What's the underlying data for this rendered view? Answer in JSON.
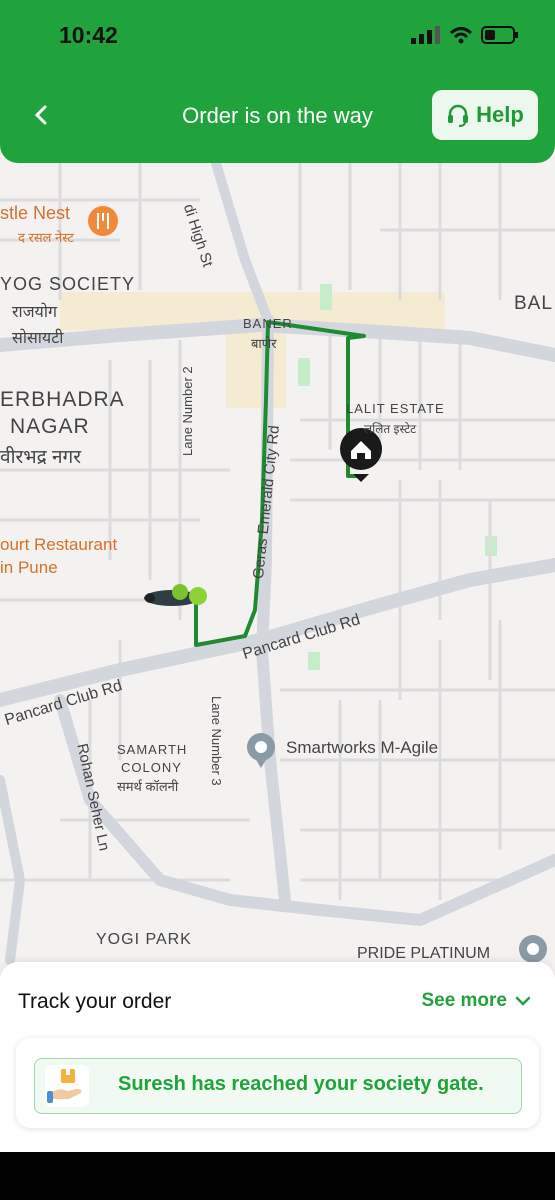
{
  "status_bar": {
    "time": "10:42"
  },
  "header": {
    "title": "Order is on the way",
    "help_label": "Help"
  },
  "map": {
    "labels": {
      "bustle_nest": "stle Nest",
      "bustle_nest_hi": "द रसल नेस्ट",
      "yog_society": "YOG SOCIETY",
      "rajyog": "राजयोग",
      "society_hi": "सोसायटी",
      "high_st": "di High St",
      "baner": "BANER",
      "baner_hi": "बाणेर",
      "bal": "BAL",
      "veerbhadra": "ERBHADRA",
      "nagar": "NAGAR",
      "veerbhadra_hi": "वीरभद्र नगर",
      "lane2": "Lane Number 2",
      "emerald": "Geras Emerald City Rd",
      "lalit": "LALIT ESTATE",
      "lalit_hi": "ललित इस्टेट",
      "restaurant1": "ourt Restaurant",
      "restaurant2": "in Pune",
      "pancard_right": "Pancard Club Rd",
      "pancard_left": "Pancard Club Rd",
      "samarth1": "SAMARTH",
      "samarth2": "COLONY",
      "samarth_hi": "समर्थ कॉलनी",
      "lane3": "Lane Number 3",
      "smartworks": "Smartworks M-Agile",
      "rohan": "Rohan Seher Ln",
      "yogi_park": "YOGI PARK",
      "pride": "PRIDE PLATINUM"
    }
  },
  "sheet": {
    "title": "Track your order",
    "see_more": "See more",
    "message": "Suresh has reached your society gate."
  },
  "colors": {
    "brand_green": "#20a33d",
    "route_green": "#1f8a32"
  }
}
